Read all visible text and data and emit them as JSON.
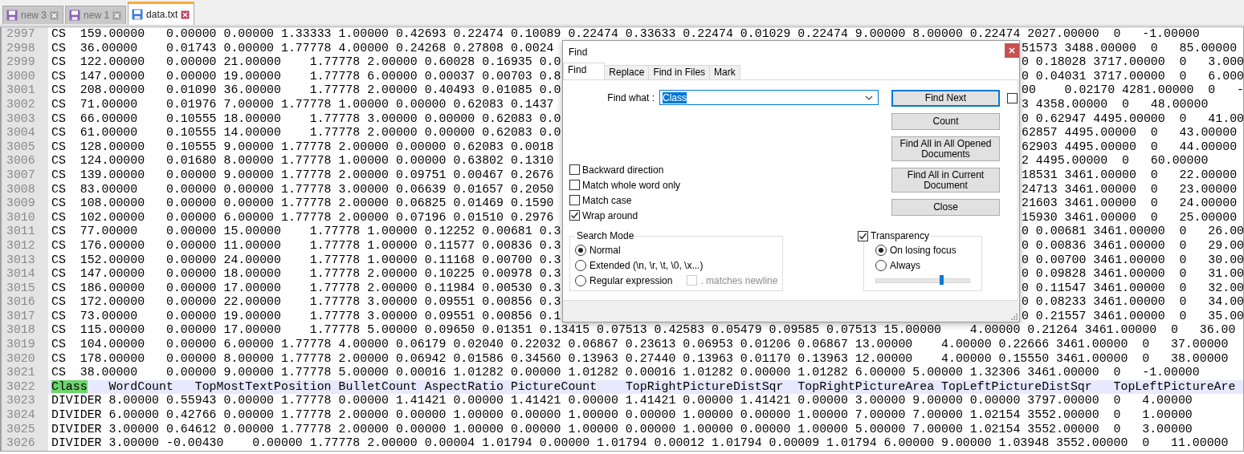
{
  "tabs": [
    {
      "label": "new 3",
      "selected": false
    },
    {
      "label": "new 1",
      "selected": false
    },
    {
      "label": "data.txt",
      "selected": true
    }
  ],
  "editor": {
    "lines": [
      {
        "number": "2997",
        "text": "CS  159.00000   0.00000 0.00000 1.33333 1.00000 0.42693 0.22474 0.10089 0.22474 0.33633 0.22474 0.01029 0.22474 9.00000 8.00000 0.22474 2027.00000  0   -1.00000",
        "current": false
      },
      {
        "number": "2998",
        "text_left": "CS  36.00000    0.01743 0.00000 1.77778 4.00000 0.24268 0.27808 0.0024",
        "text_right": "51573 3488.00000  0   85.00000",
        "current": false
      },
      {
        "number": "2999",
        "text_left": "CS  122.00000   0.00000 21.00000    1.77778 2.00000 0.60028 0.16935 0.0",
        "text_right": "0 0.18028 3717.00000  0   3.000",
        "current": false
      },
      {
        "number": "3000",
        "text_left": "CS  147.00000   0.00000 19.00000    1.77778 6.00000 0.00037 0.00703 0.8",
        "text_right": "0 0.04031 3717.00000  0   6.000",
        "current": false
      },
      {
        "number": "3001",
        "text_left": "CS  208.00000   0.01090 36.00000    1.77778 2.00000 0.40493 0.01085 0.0",
        "text_right": "00    0.02170 4281.00000  0   -",
        "current": false
      },
      {
        "number": "3002",
        "text_left": "CS  71.00000    0.01976 7.00000 1.77778 1.00000 0.00000 0.62083 0.1437",
        "text_right": "3 4358.00000  0   48.00000",
        "current": false
      },
      {
        "number": "3003",
        "text_left": "CS  66.00000    0.10555 18.00000    1.77778 3.00000 0.00000 0.62083 0.0",
        "text_right": "0 0.62947 4495.00000  0   41.00",
        "current": false
      },
      {
        "number": "3004",
        "text_left": "CS  61.00000    0.10555 14.00000    1.77778 2.00000 0.00000 0.62083 0.0",
        "text_right": "62857 4495.00000  0   43.00000",
        "current": false
      },
      {
        "number": "3005",
        "text_left": "CS  128.00000   0.10555 9.00000 1.77778 2.00000 0.00000 0.62083 0.0018",
        "text_right": "62903 4495.00000  0   44.00000",
        "current": false
      },
      {
        "number": "3006",
        "text_left": "CS  124.00000   0.01680 8.00000 1.77778 1.00000 0.00000 0.63802 0.1310",
        "text_right": "2 4495.00000  0   60.00000",
        "current": false
      },
      {
        "number": "3007",
        "text_left": "CS  139.00000   0.00000 9.00000 1.77778 2.00000 0.09751 0.00467 0.2676",
        "text_right": "18531 3461.00000  0   22.00000",
        "current": false
      },
      {
        "number": "3008",
        "text_left": "CS  83.00000    0.00000 0.00000 1.77778 3.00000 0.06639 0.01657 0.2050",
        "text_right": "24713 3461.00000  0   23.00000",
        "current": false
      },
      {
        "number": "3009",
        "text_left": "CS  108.00000   0.00000 0.00000 1.77778 2.00000 0.06825 0.01469 0.1590",
        "text_right": "21603 3461.00000  0   24.00000",
        "current": false
      },
      {
        "number": "3010",
        "text_left": "CS  102.00000   0.00000 6.00000 1.77778 2.00000 0.07196 0.01510 0.2976",
        "text_right": "15930 3461.00000  0   25.00000",
        "current": false
      },
      {
        "number": "3011",
        "text_left": "CS  77.00000    0.00000 15.00000    1.77778 1.00000 0.12252 0.00681 0.3",
        "text_right": "0 0.00681 3461.00000  0   26.00",
        "current": false
      },
      {
        "number": "3012",
        "text_left": "CS  176.00000   0.00000 11.00000    1.77778 1.00000 0.11577 0.00836 0.3",
        "text_right": "0 0.00836 3461.00000  0   29.00",
        "current": false
      },
      {
        "number": "3013",
        "text_left": "CS  152.00000   0.00000 24.00000    1.77778 1.00000 0.11168 0.00700 0.3",
        "text_right": "0 0.00700 3461.00000  0   30.00",
        "current": false
      },
      {
        "number": "3014",
        "text_left": "CS  147.00000   0.00000 18.00000    1.77778 2.00000 0.10225 0.00978 0.3",
        "text_right": "0 0.09828 3461.00000  0   31.00",
        "current": false
      },
      {
        "number": "3015",
        "text_left": "CS  186.00000   0.00000 17.00000    1.77778 2.00000 0.11984 0.00530 0.3",
        "text_right": "0 0.11547 3461.00000  0   32.00",
        "current": false
      },
      {
        "number": "3016",
        "text_left": "CS  172.00000   0.00000 22.00000    1.77778 3.00000 0.09551 0.00856 0.3",
        "text_right": "0 0.08233 3461.00000  0   34.00",
        "current": false
      },
      {
        "number": "3017",
        "text_left": "CS  73.00000    0.00000 19.00000    1.77778 3.00000 0.09551 0.00856 0.1",
        "text_right": "0 0.21557 3461.00000  0   35.00",
        "current": false
      },
      {
        "number": "3018",
        "text": "CS  115.00000   0.00000 17.00000    1.77778 5.00000 0.09650 0.01351 0.13415 0.07513 0.42583 0.05479 0.09585 0.07513 15.00000    4.00000 0.21264 3461.00000  0   36.00",
        "current": false
      },
      {
        "number": "3019",
        "text": "CS  104.00000   0.00000 6.00000 1.77778 4.00000 0.06179 0.02040 0.22032 0.06867 0.23613 0.06953 0.01206 0.06867 13.00000    4.00000 0.22666 3461.00000  0   37.00000",
        "current": false
      },
      {
        "number": "3020",
        "text": "CS  178.00000   0.00000 8.00000 1.77778 2.00000 0.06942 0.01586 0.34560 0.13963 0.27440 0.13963 0.01170 0.13963 12.00000    4.00000 0.15550 3461.00000  0   38.00000",
        "current": false
      },
      {
        "number": "3021",
        "text": "CS  38.00000    0.00000 9.00000 1.77778 5.00000 0.00016 1.01282 0.00000 1.01282 0.00016 1.01282 0.00000 1.01282 6.00000 5.00000 1.32306 3461.00000  0   -1.00000",
        "current": false
      },
      {
        "number": "3022",
        "match": "Class",
        "text": "   WordCount   TopMostTextPosition BulletCount AspectRatio PictureCount    TopRightPictureDistSqr  TopRightPictureArea TopLeftPictureDistSqr   TopLeftPictureAre",
        "current": true
      },
      {
        "number": "3023",
        "text": "DIVIDER 8.00000 0.55943 0.00000 1.77778 0.00000 1.41421 0.00000 1.41421 0.00000 1.41421 0.00000 1.41421 0.00000 3.00000 9.00000 0.00000 3797.00000  0   4.00000",
        "current": false
      },
      {
        "number": "3024",
        "text": "DIVIDER 6.00000 0.42766 0.00000 1.77778 2.00000 0.00000 1.00000 0.00000 1.00000 0.00000 1.00000 0.00000 1.00000 7.00000 7.00000 1.02154 3552.00000  0   1.00000",
        "current": false
      },
      {
        "number": "3025",
        "text": "DIVIDER 3.00000 0.64612 0.00000 1.77778 2.00000 0.00000 1.00000 0.00000 1.00000 0.00000 1.00000 0.00000 1.00000 5.00000 7.00000 1.02154 3552.00000  0   3.00000",
        "current": false
      },
      {
        "number": "3026",
        "text": "DIVIDER 3.00000 -0.00430    0.00000 1.77778 2.00000 0.00004 1.01794 0.00000 1.01794 0.00012 1.01794 0.00009 1.01794 6.00000 9.00000 1.03948 3552.00000  0   11.00000",
        "current": false
      }
    ]
  },
  "find_dialog": {
    "title": "Find",
    "tabs": [
      {
        "label": "Find",
        "selected": true
      },
      {
        "label": "Replace",
        "selected": false
      },
      {
        "label": "Find in Files",
        "selected": false
      },
      {
        "label": "Mark",
        "selected": false
      }
    ],
    "find_what": {
      "label": "Find what :",
      "value": "Class"
    },
    "buttons": [
      {
        "label": "Find Next",
        "focused": true
      },
      {
        "label": "Count",
        "focused": false
      },
      {
        "label": "Find All in All Opened Documents",
        "focused": false
      },
      {
        "label": "Find All in Current Document",
        "focused": false
      },
      {
        "label": "Close",
        "focused": false
      }
    ],
    "side_checkbox": {
      "checked": false
    },
    "options": [
      {
        "label": "Backward direction",
        "checked": false
      },
      {
        "label": "Match whole word only",
        "checked": false
      },
      {
        "label": "Match case",
        "checked": false
      },
      {
        "label": "Wrap around",
        "checked": true
      }
    ],
    "search_mode": {
      "title": "Search Mode",
      "modes": [
        {
          "label": "Normal",
          "selected": true
        },
        {
          "label": "Extended (\\n, \\r, \\t, \\0, \\x...)",
          "selected": false
        },
        {
          "label": "Regular expression",
          "selected": false
        }
      ],
      "dot_matches_newline": {
        "label": ". matches newline",
        "checked": false,
        "disabled": true
      }
    },
    "transparency": {
      "label": "Transparency",
      "checked": true,
      "modes": [
        {
          "label": "On losing focus",
          "selected": true
        },
        {
          "label": "Always",
          "selected": false
        }
      ],
      "level": 0.7
    }
  }
}
